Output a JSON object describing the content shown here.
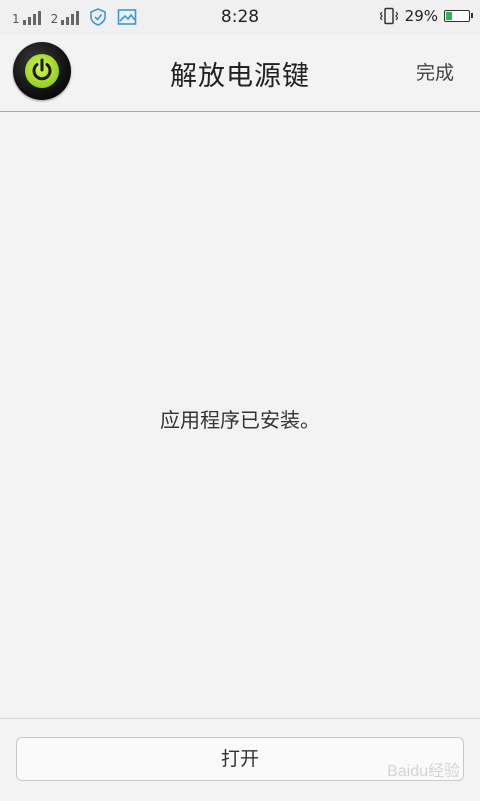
{
  "status_bar": {
    "time": "8:28",
    "battery_text": "29%",
    "battery_level": 0.29,
    "signal_1_label": "1",
    "signal_2_label": "2",
    "icons": [
      "signal-icon",
      "signal-icon",
      "shield-icon",
      "image-icon",
      "vibrate-icon",
      "battery-icon"
    ],
    "battery_color": "#2fb45a"
  },
  "header": {
    "title": "解放电源键",
    "done_label": "完成",
    "divider_color": "#5dc7d8"
  },
  "main": {
    "message": "应用程序已安装。"
  },
  "footer": {
    "open_label": "打开"
  },
  "watermark": {
    "text": "Baidu经验"
  }
}
